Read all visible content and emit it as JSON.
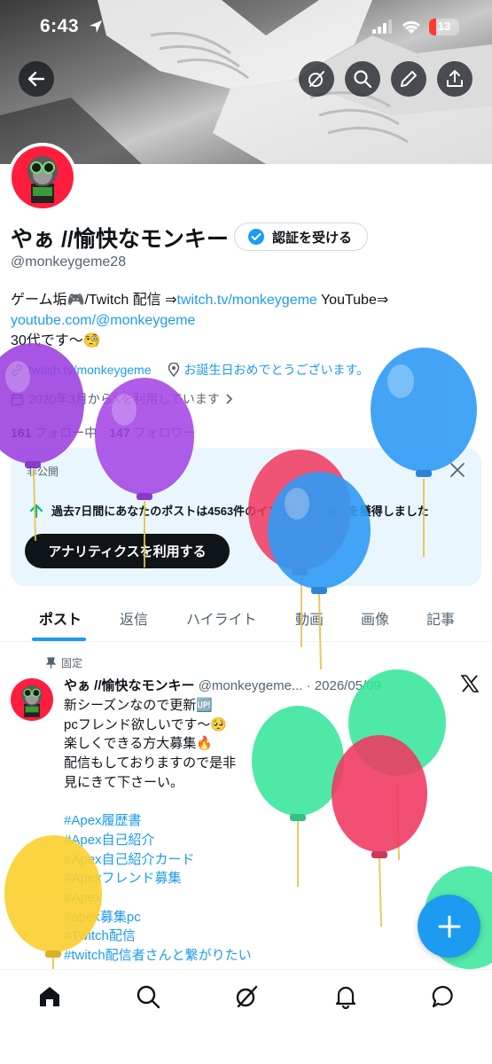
{
  "status": {
    "time": "6:43",
    "battery": "13"
  },
  "profile": {
    "name": "やぁ //愉快なモンキー",
    "verify_label": "認証を受ける",
    "handle": "@monkeygeme28",
    "bio_line1_prefix": "ゲーム垢🎮/Twitch 配信 ⇒",
    "bio_link1": "twitch.tv/monkeygeme",
    "bio_line1_suffix": " YouTube⇒",
    "bio_link2": "youtube.com/@monkeygeme",
    "bio_line3": "30代です〜🧐",
    "website": "twitch.tv/monkeygeme",
    "birthday": "お誕生日おめでとうございます。",
    "joined": "2020年3月からXを利用しています",
    "following_count": "161",
    "following_label": "フォロー中",
    "followers_count": "147",
    "followers_label": "フォロワー"
  },
  "analytics_card": {
    "private_label": "非公開",
    "impressions_text": "過去7日間にあなたのポストは4563件のインプレッションを獲得しました",
    "button_label": "アナリティクスを利用する"
  },
  "tabs": [
    {
      "label": "ポスト"
    },
    {
      "label": "返信"
    },
    {
      "label": "ハイライト"
    },
    {
      "label": "動画"
    },
    {
      "label": "画像"
    },
    {
      "label": "記事"
    }
  ],
  "post": {
    "pinned_label": "固定",
    "name": "やぁ //愉快なモンキー",
    "handle_date": "@monkeygeme... · 2026/05/09",
    "lines": [
      "新シーズンなので更新🆙",
      "pcフレンド欲しいです〜🥺",
      "楽しくできる方大募集🔥",
      "配信もしておりますので是非",
      "見にきて下さーい。"
    ],
    "hashtags": [
      "#Apex履歴書",
      "#Apex自己紹介",
      "#Apex自己紹介カード",
      "#Apexフレンド募集",
      "#Apex",
      "#apex募集pc",
      "#Twitch配信",
      "#twitch配信者さんと繋がりたい"
    ]
  },
  "colors": {
    "accent": "#1d9bf0",
    "avatar_bg": "#ff1d3e",
    "card_bg": "#eaf6fd"
  },
  "icons": {
    "back": "arrow-left-icon",
    "grok": "grok-icon",
    "search": "search-icon",
    "edit": "pencil-icon",
    "share": "share-icon",
    "home": "home-icon",
    "notifications": "bell-icon",
    "messages": "message-icon",
    "compose": "plus-icon"
  }
}
